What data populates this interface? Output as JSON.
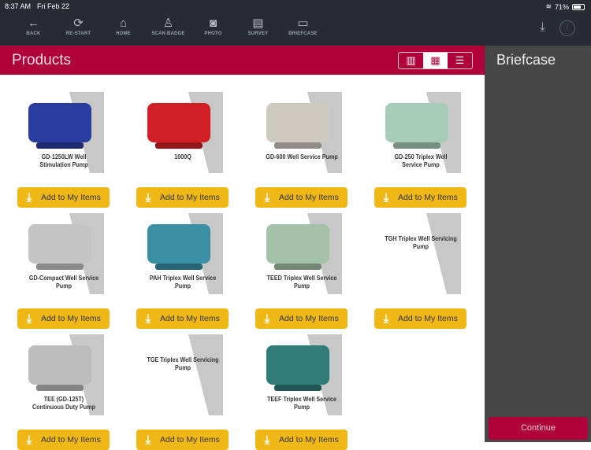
{
  "status": {
    "time": "8:37 AM",
    "date": "Fri Feb 22",
    "battery": "71%",
    "battery_level": 0.71
  },
  "nav": [
    {
      "label": "BACK",
      "icon": "←"
    },
    {
      "label": "RE-START",
      "icon": "⟳"
    },
    {
      "label": "HOME",
      "icon": "⌂"
    },
    {
      "label": "SCAN BADGE",
      "icon": "♙"
    },
    {
      "label": "PHOTO",
      "icon": "◙"
    },
    {
      "label": "SURVEY",
      "icon": "▤"
    },
    {
      "label": "BRIEFCASE",
      "icon": "▭"
    }
  ],
  "header": {
    "title": "Products",
    "views": [
      "▥",
      "▦",
      "☰"
    ]
  },
  "sidebar": {
    "title": "Briefcase",
    "continue": "Continue"
  },
  "add_label": "Add to My Items",
  "colors": {
    "accent": "#b0003a",
    "button": "#f0b816"
  },
  "products": [
    {
      "name": "GD-1250LW Well Stimulation Pump",
      "color": "#2a3c9e"
    },
    {
      "name": "1000Q",
      "color": "#d21f26"
    },
    {
      "name": "GD-600 Well Service Pump",
      "color": "#cfcac0"
    },
    {
      "name": "GD-250 Triplex Well Service Pump",
      "color": "#a6cbb6"
    },
    {
      "name": "GD-Compact Well Service Pump",
      "color": "#c4c4c4"
    },
    {
      "name": "PAH Triplex Well Service Pump",
      "color": "#3b8fa5"
    },
    {
      "name": "TEED Triplex Well Service Pump",
      "color": "#a3c2a7"
    },
    {
      "name": "TGH Triplex Well Servicing Pump",
      "color": null
    },
    {
      "name": "TEE (GD-125T) Continuous Duty Pump",
      "color": "#bdbdbd"
    },
    {
      "name": "TGE Triplex Well Servicing Pump",
      "color": null
    },
    {
      "name": "TEEF Triplex Well Service Pump",
      "color": "#2f7b78"
    }
  ]
}
